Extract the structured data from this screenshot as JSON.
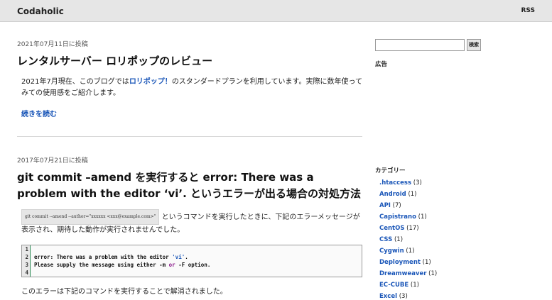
{
  "header": {
    "brand": "Codaholic",
    "rss": "RSS"
  },
  "posts": [
    {
      "date": "2021年07月11日に投稿",
      "title": "レンタルサーバー ロリポップのレビュー",
      "body_before": "2021年7月現在、このブログでは",
      "body_link": "ロリポップ！",
      "body_after": "のスタンダードプランを利用しています。実際に数年使ってみての使用感をご紹介します。",
      "more": "続きを読む"
    },
    {
      "date": "2017年07月21日に投稿",
      "title": "git commit –amend を実行すると error: There was a problem with the editor ‘vi’. というエラーが出る場合の対処方法",
      "inline_code": "git commit --amend --author=\"xxxxxx <xxx@example.com>\"",
      "intro": " というコマンドを実行したときに、下記のエラーメッセージが表示され、期待した動作が実行されませんでした。",
      "code": {
        "line_numbers": [
          "1",
          "2",
          "3",
          "4"
        ],
        "l2_a": "error: There was a problem with the editor ",
        "l2_str": "'vi'",
        "l2_b": ".",
        "l3_a": "Please supply the message using either -m ",
        "l3_kw": "or",
        "l3_b": " -F option."
      },
      "after": "このエラーは下記のコマンドを実行することで解消されました。"
    }
  ],
  "sidebar": {
    "search_button": "検索",
    "ad_title": "広告",
    "categories_title": "カテゴリー",
    "categories": [
      {
        "name": ".htaccess",
        "count": " (3)"
      },
      {
        "name": "Android",
        "count": " (1)"
      },
      {
        "name": "API",
        "count": " (7)"
      },
      {
        "name": "Capistrano",
        "count": " (1)"
      },
      {
        "name": "CentOS",
        "count": " (17)"
      },
      {
        "name": "CSS",
        "count": " (1)"
      },
      {
        "name": "Cygwin",
        "count": " (1)"
      },
      {
        "name": "Deployment",
        "count": " (1)"
      },
      {
        "name": "Dreamweaver",
        "count": " (1)"
      },
      {
        "name": "EC-CUBE",
        "count": " (1)"
      },
      {
        "name": "Excel",
        "count": " (3)"
      }
    ]
  }
}
